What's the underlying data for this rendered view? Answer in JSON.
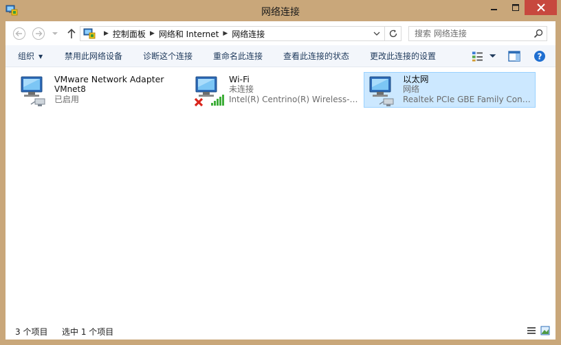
{
  "window": {
    "title": "网络连接",
    "accent_titlebar": "#c9a77a",
    "close_color": "#c7483e"
  },
  "address": {
    "breadcrumb": [
      "控制面板",
      "网络和 Internet",
      "网络连接"
    ],
    "search_placeholder": "搜索 网络连接"
  },
  "toolbar": {
    "organize": "组织",
    "disable": "禁用此网络设备",
    "diagnose": "诊断这个连接",
    "rename": "重命名此连接",
    "view_status": "查看此连接的状态",
    "change_settings": "更改此连接的设置"
  },
  "connections": [
    {
      "name": "VMware Network Adapter",
      "line2": "VMnet8",
      "line3": "已启用",
      "selected": false,
      "icon": "network-adapter-icon"
    },
    {
      "name": "Wi-Fi",
      "line2": "未连接",
      "line3": "Intel(R) Centrino(R) Wireless-N...",
      "selected": false,
      "icon": "wifi-adapter-icon"
    },
    {
      "name": "以太网",
      "line2": "网络",
      "line3": "Realtek PCIe GBE Family Contr...",
      "selected": true,
      "icon": "ethernet-adapter-icon"
    }
  ],
  "status": {
    "count": "3 个项目",
    "selected": "选中 1 个项目"
  }
}
